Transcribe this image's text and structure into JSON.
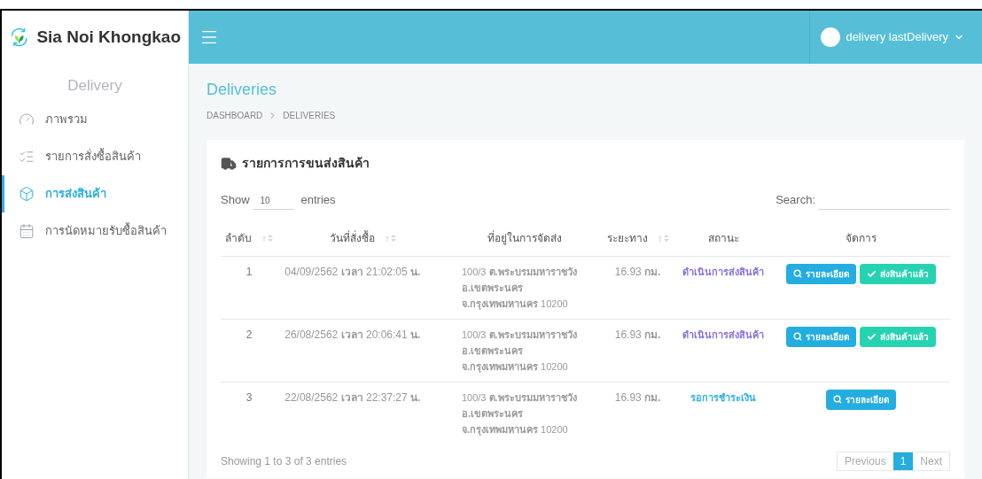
{
  "brand": {
    "name": "Sia Noi Khongkao"
  },
  "user": {
    "name": "delivery lastDelivery"
  },
  "sidebar": {
    "title": "Delivery",
    "items": [
      {
        "label": "ภาพรวม",
        "selected": false
      },
      {
        "label": "รายการสั่งซื้อสินค้า",
        "selected": false
      },
      {
        "label": "การส่งสินค้า",
        "selected": true
      },
      {
        "label": "การนัดหมายรับซื้อสินค้า",
        "selected": false
      }
    ]
  },
  "page": {
    "title": "Deliveries",
    "breadcrumb": [
      "DASHBOARD",
      "DELIVERIES"
    ]
  },
  "card": {
    "title": "รายการการขนส่งสินค้า",
    "length": {
      "before": "Show",
      "value": "10",
      "after": "entries"
    },
    "search": {
      "label": "Search:"
    },
    "columns": [
      {
        "label": "ลำดับ",
        "sortable": true
      },
      {
        "label": "วันที่สั่งซื้อ",
        "sortable": true
      },
      {
        "label": "ที่อยู่ในการจัดส่ง",
        "sortable": false
      },
      {
        "label": "ระยะทาง",
        "sortable": true
      },
      {
        "label": "สถานะ",
        "sortable": false
      },
      {
        "label": "จัดการ",
        "sortable": false
      }
    ],
    "rows": [
      {
        "no": "1",
        "date": "04/09/2562 **เวลา** 21:02:05 **น.**",
        "address": [
          "100/3 **ต.พระบรมมหาราชวัง**",
          "**อ.เขตพระนคร**",
          "**จ.กรุงเทพมหานคร** 10200"
        ],
        "distance": "16.93 **กม.**",
        "status": {
          "label": "ดำเนินการส่งสินค้า",
          "color": "#8a6fe0"
        },
        "actions": [
          {
            "kind": "detail",
            "label": "รายละเอียด"
          },
          {
            "kind": "done",
            "label": "ส่งสินค้าแล้ว"
          }
        ]
      },
      {
        "no": "2",
        "date": "26/08/2562 **เวลา** 20:06:41 **น.**",
        "address": [
          "100/3 **ต.พระบรมมหาราชวัง**",
          "**อ.เขตพระนคร**",
          "**จ.กรุงเทพมหานคร** 10200"
        ],
        "distance": "16.93 **กม.**",
        "status": {
          "label": "ดำเนินการส่งสินค้า",
          "color": "#8a6fe0"
        },
        "actions": [
          {
            "kind": "detail",
            "label": "รายละเอียด"
          },
          {
            "kind": "done",
            "label": "ส่งสินค้าแล้ว"
          }
        ]
      },
      {
        "no": "3",
        "date": "22/08/2562 **เวลา** 22:37:27 **น.**",
        "address": [
          "100/3 **ต.พระบรมมหาราชวัง**",
          "**อ.เขตพระนคร**",
          "**จ.กรุงเทพมหานคร** 10200"
        ],
        "distance": "16.93 **กม.**",
        "status": {
          "label": "รอการชำระเงิน",
          "color": "#2eaee0"
        },
        "actions": [
          {
            "kind": "detail",
            "label": "รายละเอียด"
          }
        ]
      }
    ],
    "info": "Showing 1 to 3 of 3 entries",
    "pagination": {
      "previous": "Previous",
      "pages": [
        {
          "label": "1",
          "selected": true
        }
      ],
      "next": "Next"
    }
  }
}
